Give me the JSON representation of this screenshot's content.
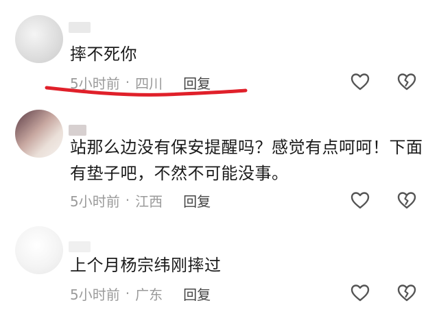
{
  "comments": [
    {
      "text": "摔不死你",
      "time": "5小时前",
      "separator": "·",
      "location": "四川",
      "reply_label": "回复"
    },
    {
      "text": "站那么边没有保安提醒吗？感觉有点呵呵！下面有垫子吧，不然不可能没事。",
      "time": "5小时前",
      "separator": "·",
      "location": "江西",
      "reply_label": "回复"
    },
    {
      "text": "上个月杨宗纬刚摔过",
      "time": "5小时前",
      "separator": "·",
      "location": "广东",
      "reply_label": "回复"
    }
  ],
  "icons": {
    "like": "heart-icon",
    "dislike": "broken-heart-icon"
  },
  "colors": {
    "annotation": "#e0202a",
    "meta_text": "#9a9a9a",
    "body_text": "#1a1a1a",
    "icon_stroke": "#555555"
  }
}
